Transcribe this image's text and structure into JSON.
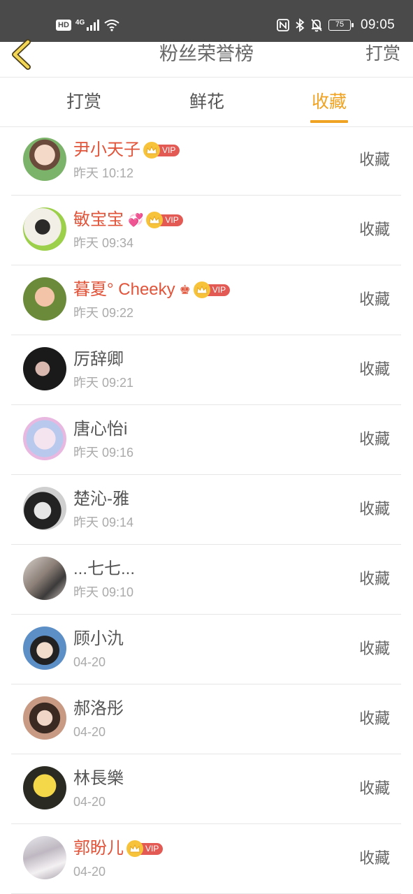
{
  "status_bar": {
    "hd": "HD",
    "network": "4G",
    "battery": "75",
    "time": "09:05"
  },
  "header": {
    "title": "粉丝荣誉榜",
    "right_link": "打赏"
  },
  "tabs": [
    {
      "label": "打赏",
      "active": false
    },
    {
      "label": "鲜花",
      "active": false
    },
    {
      "label": "收藏",
      "active": true
    }
  ],
  "colors": {
    "accent": "#f0a323",
    "vip_name": "#e2543a",
    "vip_tag": "#e35a55"
  },
  "list": [
    {
      "name": "尹小天子",
      "time": "昨天 10:12",
      "action": "收藏",
      "vip": true,
      "vip_label": "VIP"
    },
    {
      "name": "敏宝宝",
      "time": "昨天 09:34",
      "action": "收藏",
      "vip": true,
      "vip_label": "VIP",
      "extra_icon": "💞"
    },
    {
      "name": "暮夏° Cheeky",
      "time": "昨天 09:22",
      "action": "收藏",
      "vip": true,
      "vip_label": "VIP",
      "extra_icon": "♚"
    },
    {
      "name": "厉辞卿",
      "time": "昨天 09:21",
      "action": "收藏",
      "vip": false
    },
    {
      "name": "唐心怡i",
      "time": "昨天 09:16",
      "action": "收藏",
      "vip": false
    },
    {
      "name": "楚沁-雅",
      "time": "昨天 09:14",
      "action": "收藏",
      "vip": false
    },
    {
      "name": "...七七...",
      "time": "昨天 09:10",
      "action": "收藏",
      "vip": false
    },
    {
      "name": "顾小氿",
      "time": "04-20",
      "action": "收藏",
      "vip": false
    },
    {
      "name": "郝洛彤",
      "time": "04-20",
      "action": "收藏",
      "vip": false
    },
    {
      "name": "林長樂",
      "time": "04-20",
      "action": "收藏",
      "vip": false
    },
    {
      "name": "郭盼儿",
      "time": "04-20",
      "action": "收藏",
      "vip": true,
      "vip_label": "VIP"
    }
  ]
}
